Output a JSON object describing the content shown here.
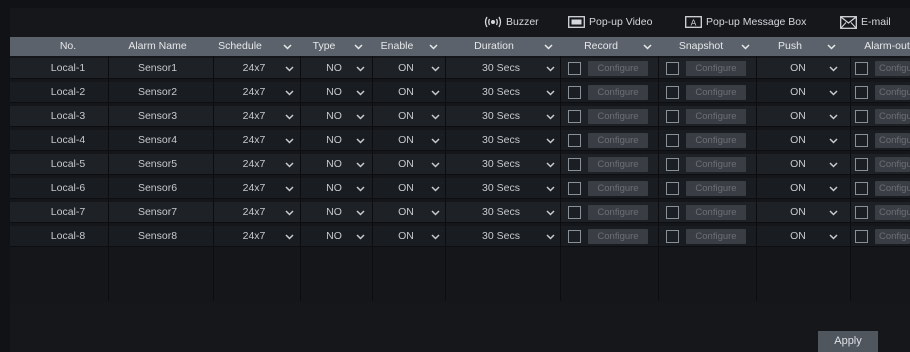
{
  "toolbar": {
    "buzzer_label": "Buzzer",
    "popup_video_label": "Pop-up Video",
    "popup_message_label": "Pop-up Message Box",
    "email_label": "E-mail"
  },
  "table": {
    "headers": {
      "no": "No.",
      "alarm_name": "Alarm Name",
      "schedule": "Schedule",
      "type": "Type",
      "enable": "Enable",
      "duration": "Duration",
      "record": "Record",
      "snapshot": "Snapshot",
      "push": "Push",
      "alarm_out": "Alarm-out"
    },
    "configure_label": "Configure",
    "rows": [
      {
        "no": "Local-1",
        "name": "Sensor1",
        "schedule": "24x7",
        "type": "NO",
        "enable": "ON",
        "duration": "30 Secs",
        "push": "ON"
      },
      {
        "no": "Local-2",
        "name": "Sensor2",
        "schedule": "24x7",
        "type": "NO",
        "enable": "ON",
        "duration": "30 Secs",
        "push": "ON"
      },
      {
        "no": "Local-3",
        "name": "Sensor3",
        "schedule": "24x7",
        "type": "NO",
        "enable": "ON",
        "duration": "30 Secs",
        "push": "ON"
      },
      {
        "no": "Local-4",
        "name": "Sensor4",
        "schedule": "24x7",
        "type": "NO",
        "enable": "ON",
        "duration": "30 Secs",
        "push": "ON"
      },
      {
        "no": "Local-5",
        "name": "Sensor5",
        "schedule": "24x7",
        "type": "NO",
        "enable": "ON",
        "duration": "30 Secs",
        "push": "ON"
      },
      {
        "no": "Local-6",
        "name": "Sensor6",
        "schedule": "24x7",
        "type": "NO",
        "enable": "ON",
        "duration": "30 Secs",
        "push": "ON"
      },
      {
        "no": "Local-7",
        "name": "Sensor7",
        "schedule": "24x7",
        "type": "NO",
        "enable": "ON",
        "duration": "30 Secs",
        "push": "ON"
      },
      {
        "no": "Local-8",
        "name": "Sensor8",
        "schedule": "24x7",
        "type": "NO",
        "enable": "ON",
        "duration": "30 Secs",
        "push": "ON"
      }
    ]
  },
  "footer": {
    "apply_label": "Apply"
  },
  "colors": {
    "header_bg": "#5b626b",
    "row_even": "#1e2227",
    "row_odd": "#191c21",
    "button_bg": "#4f565e"
  },
  "icons": [
    "buzzer-icon",
    "popup-video-icon",
    "popup-message-icon",
    "email-icon",
    "chevron-down-icon",
    "scroll-left-icon",
    "scroll-right-icon"
  ]
}
